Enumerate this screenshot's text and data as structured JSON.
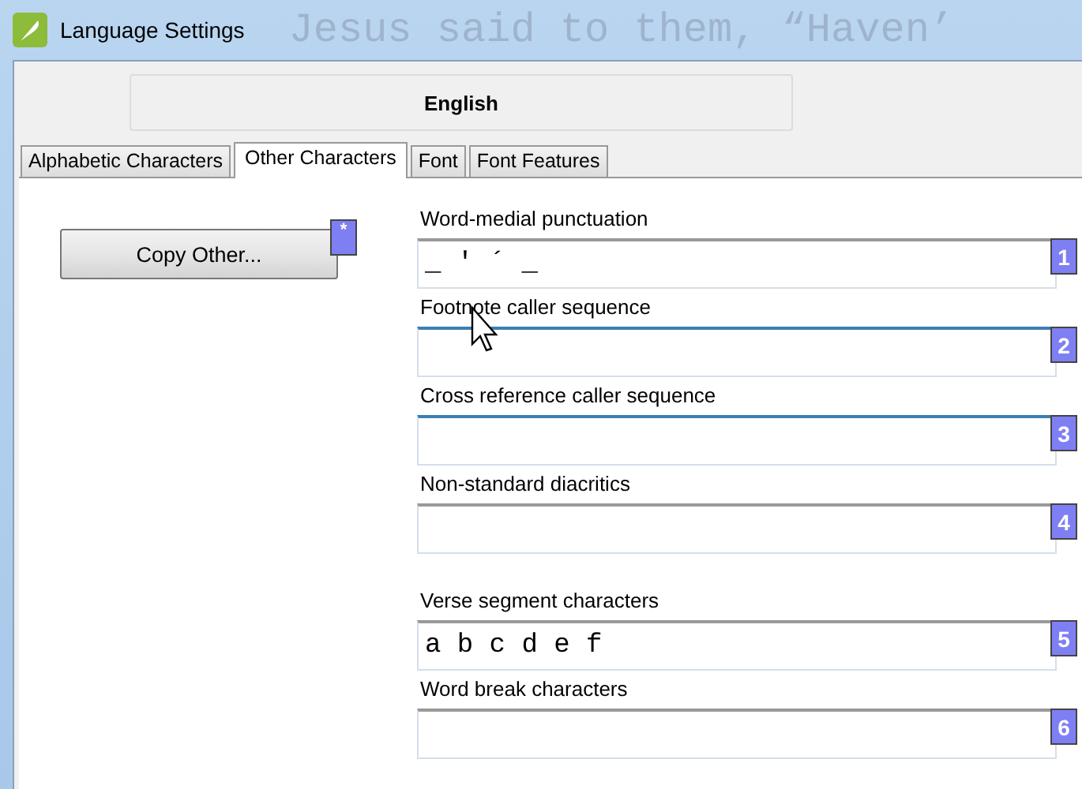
{
  "window": {
    "title": "Language Settings",
    "background_text": "Jesus said to them, “Haven’"
  },
  "language": "English",
  "tabs": [
    {
      "label": "Alphabetic Characters",
      "selected": false
    },
    {
      "label": "Other Characters",
      "selected": true
    },
    {
      "label": "Font",
      "selected": false
    },
    {
      "label": "Font Features",
      "selected": false
    }
  ],
  "copy_button": {
    "label": "Copy Other...",
    "badge": "*"
  },
  "fields": [
    {
      "label": "Word-medial punctuation",
      "value": "_ ' ´ _",
      "badge": "1",
      "hover": false
    },
    {
      "label": "Footnote caller sequence",
      "badge": "2",
      "hover": true
    },
    {
      "label": "Cross reference caller sequence",
      "badge": "3",
      "hover": true
    },
    {
      "label": "Non-standard diacritics",
      "badge": "4",
      "hover": false
    },
    {
      "label": "Verse segment characters",
      "value": "a b c d e f",
      "badge": "5",
      "hover": false
    },
    {
      "label": "Word break characters",
      "badge": "6",
      "hover": false
    }
  ]
}
